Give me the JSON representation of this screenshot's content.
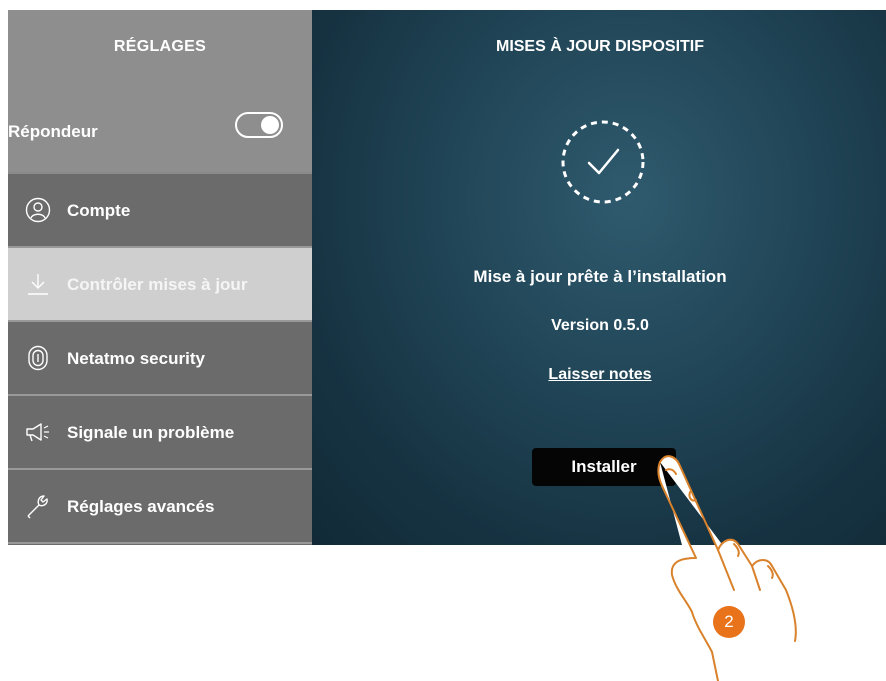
{
  "sidebar": {
    "title": "RÉGLAGES",
    "answering_machine": {
      "label": "Répondeur",
      "toggle_on": true
    },
    "items": [
      {
        "label": "Compte",
        "icon": "user-circle-icon",
        "active": false
      },
      {
        "label": "Contrôler mises à jour",
        "icon": "download-icon",
        "active": true
      },
      {
        "label": "Netatmo security",
        "icon": "fingerprint-icon",
        "active": false
      },
      {
        "label": "Signale un problème",
        "icon": "megaphone-icon",
        "active": false
      },
      {
        "label": "Réglages avancés",
        "icon": "wrench-icon",
        "active": false
      }
    ]
  },
  "main": {
    "title": "MISES À JOUR DISPOSITIF",
    "status_icon": "check-circle-icon",
    "status_text": "Mise à jour prête à l’installation",
    "version": "Version 0.5.0",
    "notes_link": "Laisser notes",
    "install_button": "Installer"
  },
  "annotation": {
    "step_number": "2",
    "badge_color": "#e8731a",
    "hand_icon": "pointing-hand-icon"
  },
  "colors": {
    "sidebar_header": "#8e8e8e",
    "sidebar_item": "#6b6b6b",
    "active_item": "#cfcfcf",
    "main_bg": "#1f4354",
    "button": "#050505"
  }
}
